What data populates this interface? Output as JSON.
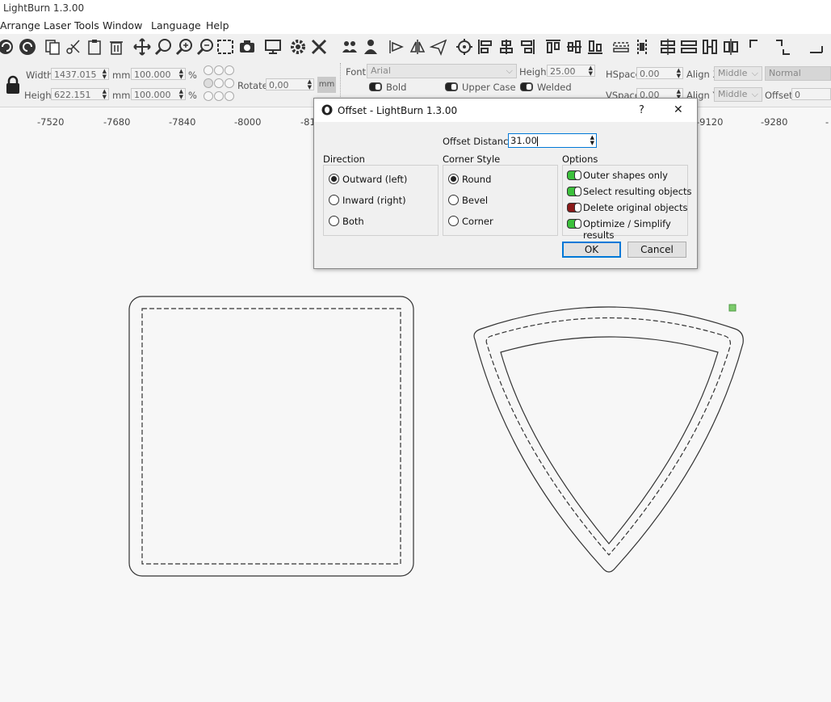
{
  "window": {
    "title": "LightBurn 1.3.00"
  },
  "menu": {
    "items": [
      "Arrange",
      "Laser Tools",
      "Window",
      "Language",
      "Help"
    ]
  },
  "props": {
    "width_label": "Width",
    "width_value": "1437.015",
    "width_unit": "mm",
    "height_label": "Height",
    "height_value": "622.151",
    "height_unit": "mm",
    "scale_w": "100.000",
    "scale_h": "100.000",
    "percent": "%",
    "rotate_label": "Rotate",
    "rotate_value": "0,00",
    "rotate_unit": "mm",
    "font_label": "Font",
    "font_value": "Arial",
    "text_height_label": "Height",
    "text_height_value": "25.00",
    "bold_label": "Bold",
    "upper_label": "Upper Case",
    "welded_label": "Welded",
    "hspace_label": "HSpace",
    "hspace_value": "0.00",
    "vspace_label": "VSpace",
    "vspace_value": "0.00",
    "alignx_label": "Align X",
    "alignx_value": "Middle",
    "aligny_label": "Align Y",
    "aligny_value": "Middle",
    "mode_value": "Normal",
    "offset_label": "Offset",
    "offset_value": "0"
  },
  "ruler": {
    "ticks": [
      "-7520",
      "-7680",
      "-7840",
      "-8000",
      "-81",
      "-9120",
      "-9280",
      "-"
    ]
  },
  "dialog": {
    "title": "Offset - LightBurn 1.3.00",
    "help": "?",
    "close": "✕",
    "offset_label": "Offset Distance",
    "offset_value": "31.00",
    "direction": {
      "title": "Direction",
      "options": [
        "Outward (left)",
        "Inward (right)",
        "Both"
      ],
      "selected": 0
    },
    "corner": {
      "title": "Corner Style",
      "options": [
        "Round",
        "Bevel",
        "Corner"
      ],
      "selected": 0
    },
    "options": {
      "title": "Options",
      "items": [
        {
          "label": "Outer shapes only",
          "on": true
        },
        {
          "label": "Select resulting objects",
          "on": true
        },
        {
          "label": "Delete original objects",
          "on": false
        },
        {
          "label": "Optimize / Simplify results",
          "on": true
        }
      ]
    },
    "ok": "OK",
    "cancel": "Cancel"
  },
  "colors": {
    "toggle_on": "#3cc13c",
    "toggle_off": "#8b1a1a",
    "handle": "#7ccb6c",
    "accent": "#0078d7"
  }
}
